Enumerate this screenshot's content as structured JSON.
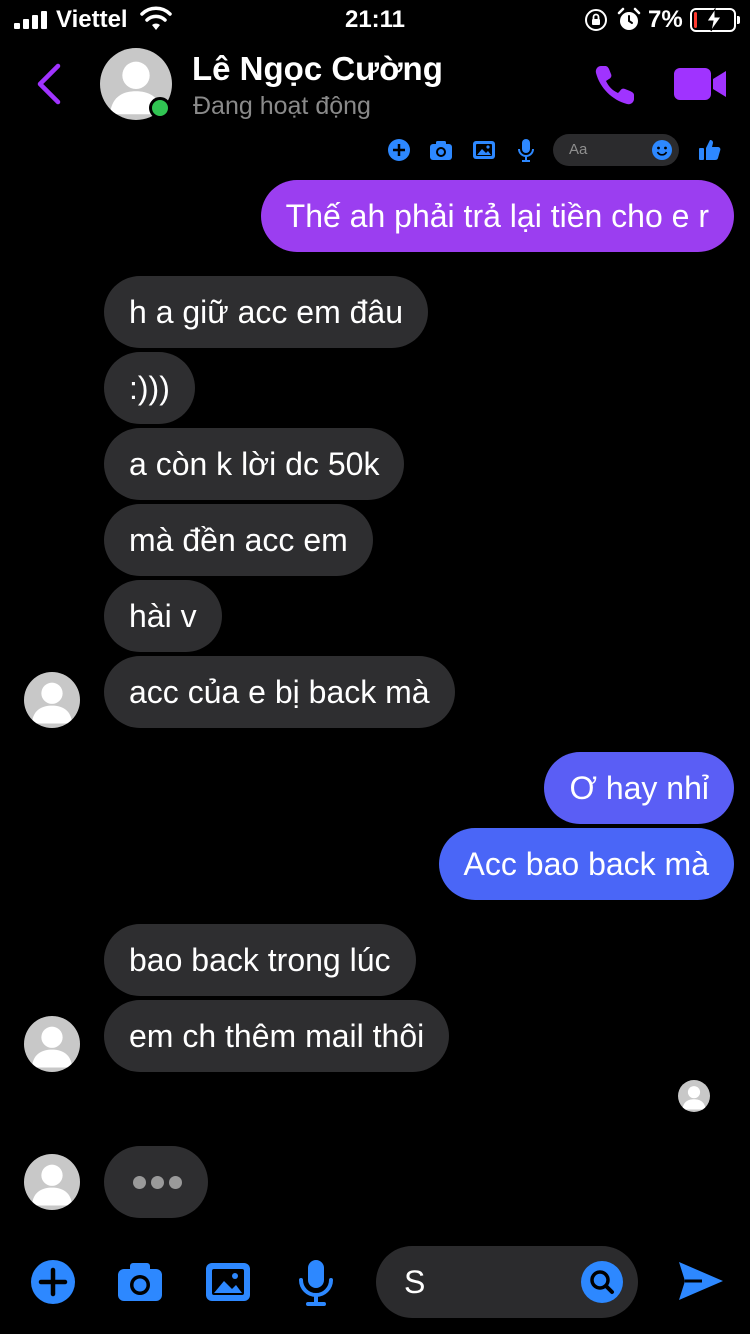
{
  "status_bar": {
    "carrier": "Viettel",
    "time": "21:11",
    "battery_percent": "7%",
    "battery_level": 0.07
  },
  "header": {
    "contact_name": "Lê Ngọc Cường",
    "contact_status": "Đang hoạt động",
    "accent_color": "#a033ff",
    "online_color": "#31c553"
  },
  "mini_composer": {
    "placeholder": "Aa"
  },
  "messages": [
    {
      "side": "out",
      "text": "Thế ah phải trả lại tiền cho e r",
      "color": "#9b3ef0"
    },
    {
      "side": "in",
      "text": "h a giữ acc em đâu"
    },
    {
      "side": "in",
      "text": ":)))"
    },
    {
      "side": "in",
      "text": "a còn k lời dc 50k"
    },
    {
      "side": "in",
      "text": "mà đền acc em"
    },
    {
      "side": "in",
      "text": "hài v"
    },
    {
      "side": "in",
      "text": "acc của e bị back mà"
    },
    {
      "side": "out",
      "text": "Ơ hay nhỉ",
      "color": "#5a5ef5"
    },
    {
      "side": "out",
      "text": "Acc bao back mà",
      "color": "#4a66f7"
    },
    {
      "side": "in",
      "text": "bao back trong lúc"
    },
    {
      "side": "in",
      "text": "em ch thêm mail thôi"
    }
  ],
  "composer": {
    "input_value": "S",
    "icon_color": "#2d88ff"
  }
}
